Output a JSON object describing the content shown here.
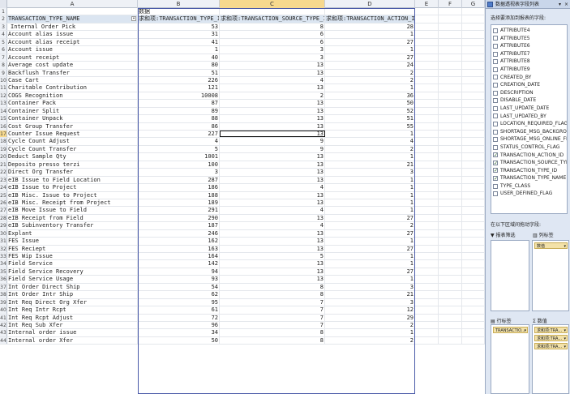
{
  "columns": [
    "A",
    "B",
    "C",
    "D",
    "E",
    "F",
    "G"
  ],
  "active_column": "C",
  "active_row": "17",
  "row1": {
    "num": "1",
    "b": "数据"
  },
  "headers": {
    "num": "2",
    "a": "TRANSACTION_TYPE_NAME",
    "b": "求和项:TRANSACTION_TYPE_ID",
    "c": "求和项:TRANSACTION_SOURCE_TYPE_ID",
    "d": "求和项:TRANSACTION_ACTION_ID"
  },
  "rows": [
    {
      "n": "3",
      "name": "Internal Order Pick",
      "type_id": "53",
      "source": "8",
      "action": "28"
    },
    {
      "n": "4",
      "name": "Account alias issue",
      "type_id": "31",
      "source": "6",
      "action": "1"
    },
    {
      "n": "5",
      "name": "Account alias receipt",
      "type_id": "41",
      "source": "6",
      "action": "27"
    },
    {
      "n": "6",
      "name": "Account issue",
      "type_id": "1",
      "source": "3",
      "action": "1"
    },
    {
      "n": "7",
      "name": "Account receipt",
      "type_id": "40",
      "source": "3",
      "action": "27"
    },
    {
      "n": "8",
      "name": "Average cost update",
      "type_id": "80",
      "source": "13",
      "action": "24"
    },
    {
      "n": "9",
      "name": "Backflush Transfer",
      "type_id": "51",
      "source": "13",
      "action": "2"
    },
    {
      "n": "10",
      "name": "Case Cart",
      "type_id": "226",
      "source": "4",
      "action": "2"
    },
    {
      "n": "11",
      "name": "Charitable Contribution",
      "type_id": "121",
      "source": "13",
      "action": "1"
    },
    {
      "n": "12",
      "name": "COGS Recognition",
      "type_id": "10008",
      "source": "2",
      "action": "36"
    },
    {
      "n": "13",
      "name": "Container Pack",
      "type_id": "87",
      "source": "13",
      "action": "50"
    },
    {
      "n": "14",
      "name": "Container Split",
      "type_id": "89",
      "source": "13",
      "action": "52"
    },
    {
      "n": "15",
      "name": "Container Unpack",
      "type_id": "88",
      "source": "13",
      "action": "51"
    },
    {
      "n": "16",
      "name": "Cost Group Transfer",
      "type_id": "86",
      "source": "13",
      "action": "55"
    },
    {
      "n": "17",
      "name": "Counter Issue Request",
      "type_id": "227",
      "source": "13",
      "action": "1"
    },
    {
      "n": "18",
      "name": "Cycle Count Adjust",
      "type_id": "4",
      "source": "9",
      "action": "4"
    },
    {
      "n": "19",
      "name": "Cycle Count Transfer",
      "type_id": "5",
      "source": "9",
      "action": "2"
    },
    {
      "n": "20",
      "name": "Deduct Sample Qty",
      "type_id": "1001",
      "source": "13",
      "action": "1"
    },
    {
      "n": "21",
      "name": "Deposito presso terzi",
      "type_id": "100",
      "source": "13",
      "action": "21"
    },
    {
      "n": "22",
      "name": "Direct Org Transfer",
      "type_id": "3",
      "source": "13",
      "action": "3"
    },
    {
      "n": "23",
      "name": "eIB Issue to Field Location",
      "type_id": "287",
      "source": "13",
      "action": "1"
    },
    {
      "n": "24",
      "name": "eIB Issue to Project",
      "type_id": "186",
      "source": "4",
      "action": "1"
    },
    {
      "n": "25",
      "name": "eIB Misc. Issue to Project",
      "type_id": "188",
      "source": "13",
      "action": "1"
    },
    {
      "n": "26",
      "name": "eIB Misc. Receipt from Project",
      "type_id": "189",
      "source": "13",
      "action": "1"
    },
    {
      "n": "27",
      "name": "eIB Move Issue to Field",
      "type_id": "291",
      "source": "4",
      "action": "1"
    },
    {
      "n": "28",
      "name": "eIB Receipt from Field",
      "type_id": "290",
      "source": "13",
      "action": "27"
    },
    {
      "n": "29",
      "name": "eIB Subinventory Transfer",
      "type_id": "187",
      "source": "4",
      "action": "2"
    },
    {
      "n": "30",
      "name": "Explant",
      "type_id": "246",
      "source": "13",
      "action": "27"
    },
    {
      "n": "31",
      "name": "FES Issue",
      "type_id": "162",
      "source": "13",
      "action": "1"
    },
    {
      "n": "32",
      "name": "FES Reciept",
      "type_id": "163",
      "source": "13",
      "action": "27"
    },
    {
      "n": "33",
      "name": "FES Wip Issue",
      "type_id": "164",
      "source": "5",
      "action": "1"
    },
    {
      "n": "34",
      "name": "Field Service",
      "type_id": "142",
      "source": "13",
      "action": "1"
    },
    {
      "n": "35",
      "name": "Field Service Recovery",
      "type_id": "94",
      "source": "13",
      "action": "27"
    },
    {
      "n": "36",
      "name": "Field Service Usage",
      "type_id": "93",
      "source": "13",
      "action": "1"
    },
    {
      "n": "37",
      "name": "Int Order Direct Ship",
      "type_id": "54",
      "source": "8",
      "action": "3"
    },
    {
      "n": "38",
      "name": "Int Order Intr Ship",
      "type_id": "62",
      "source": "8",
      "action": "21"
    },
    {
      "n": "39",
      "name": "Int Req Direct Org Xfer",
      "type_id": "95",
      "source": "7",
      "action": "3"
    },
    {
      "n": "40",
      "name": "Int Req Intr Rcpt",
      "type_id": "61",
      "source": "7",
      "action": "12"
    },
    {
      "n": "41",
      "name": "Int Req Rcpt Adjust",
      "type_id": "72",
      "source": "7",
      "action": "29"
    },
    {
      "n": "42",
      "name": "Int Req Sub Xfer",
      "type_id": "96",
      "source": "7",
      "action": "2"
    },
    {
      "n": "43",
      "name": "Internal order issue",
      "type_id": "34",
      "source": "8",
      "action": "1"
    },
    {
      "n": "44",
      "name": "Internal order Xfer",
      "type_id": "50",
      "source": "8",
      "action": "2"
    }
  ],
  "pane": {
    "title": "数据透视表字段列表",
    "menu_glyph": "▾",
    "close_glyph": "×",
    "choose_label": "选择要添加到报表的字段:",
    "fields": [
      {
        "name": "ATTRIBUTE4",
        "checked": false
      },
      {
        "name": "ATTRIBUTE5",
        "checked": false
      },
      {
        "name": "ATTRIBUTE6",
        "checked": false
      },
      {
        "name": "ATTRIBUTE7",
        "checked": false
      },
      {
        "name": "ATTRIBUTE8",
        "checked": false
      },
      {
        "name": "ATTRIBUTE9",
        "checked": false
      },
      {
        "name": "CREATED_BY",
        "checked": false
      },
      {
        "name": "CREATION_DATE",
        "checked": false
      },
      {
        "name": "DESCRIPTION",
        "checked": false
      },
      {
        "name": "DISABLE_DATE",
        "checked": false
      },
      {
        "name": "LAST_UPDATE_DATE",
        "checked": false
      },
      {
        "name": "LAST_UPDATED_BY",
        "checked": false
      },
      {
        "name": "LOCATION_REQUIRED_FLAG",
        "checked": false
      },
      {
        "name": "SHORTAGE_MSG_BACKGROUND_FLAG",
        "checked": false
      },
      {
        "name": "SHORTAGE_MSG_ONLINE_FLAG",
        "checked": false
      },
      {
        "name": "STATUS_CONTROL_FLAG",
        "checked": false
      },
      {
        "name": "TRANSACTION_ACTION_ID",
        "checked": true
      },
      {
        "name": "TRANSACTION_SOURCE_TYPE_ID",
        "checked": true
      },
      {
        "name": "TRANSACTION_TYPE_ID",
        "checked": true
      },
      {
        "name": "TRANSACTION_TYPE_NAME",
        "checked": true
      },
      {
        "name": "TYPE_CLASS",
        "checked": false
      },
      {
        "name": "USER_DEFINED_FLAG",
        "checked": false
      }
    ],
    "drag_label": "在以下区域间拖动字段:",
    "report_filter": "报表筛选",
    "column_labels": "列标签",
    "column_chip": "数值",
    "row_labels": "行标签",
    "values_label": "数值",
    "row_chip": "TRANSACTIO...",
    "value_chips": [
      "求和项:TRA...",
      "求和项:TRA...",
      "求和项:TRA..."
    ],
    "chip_arrow": "▾"
  }
}
